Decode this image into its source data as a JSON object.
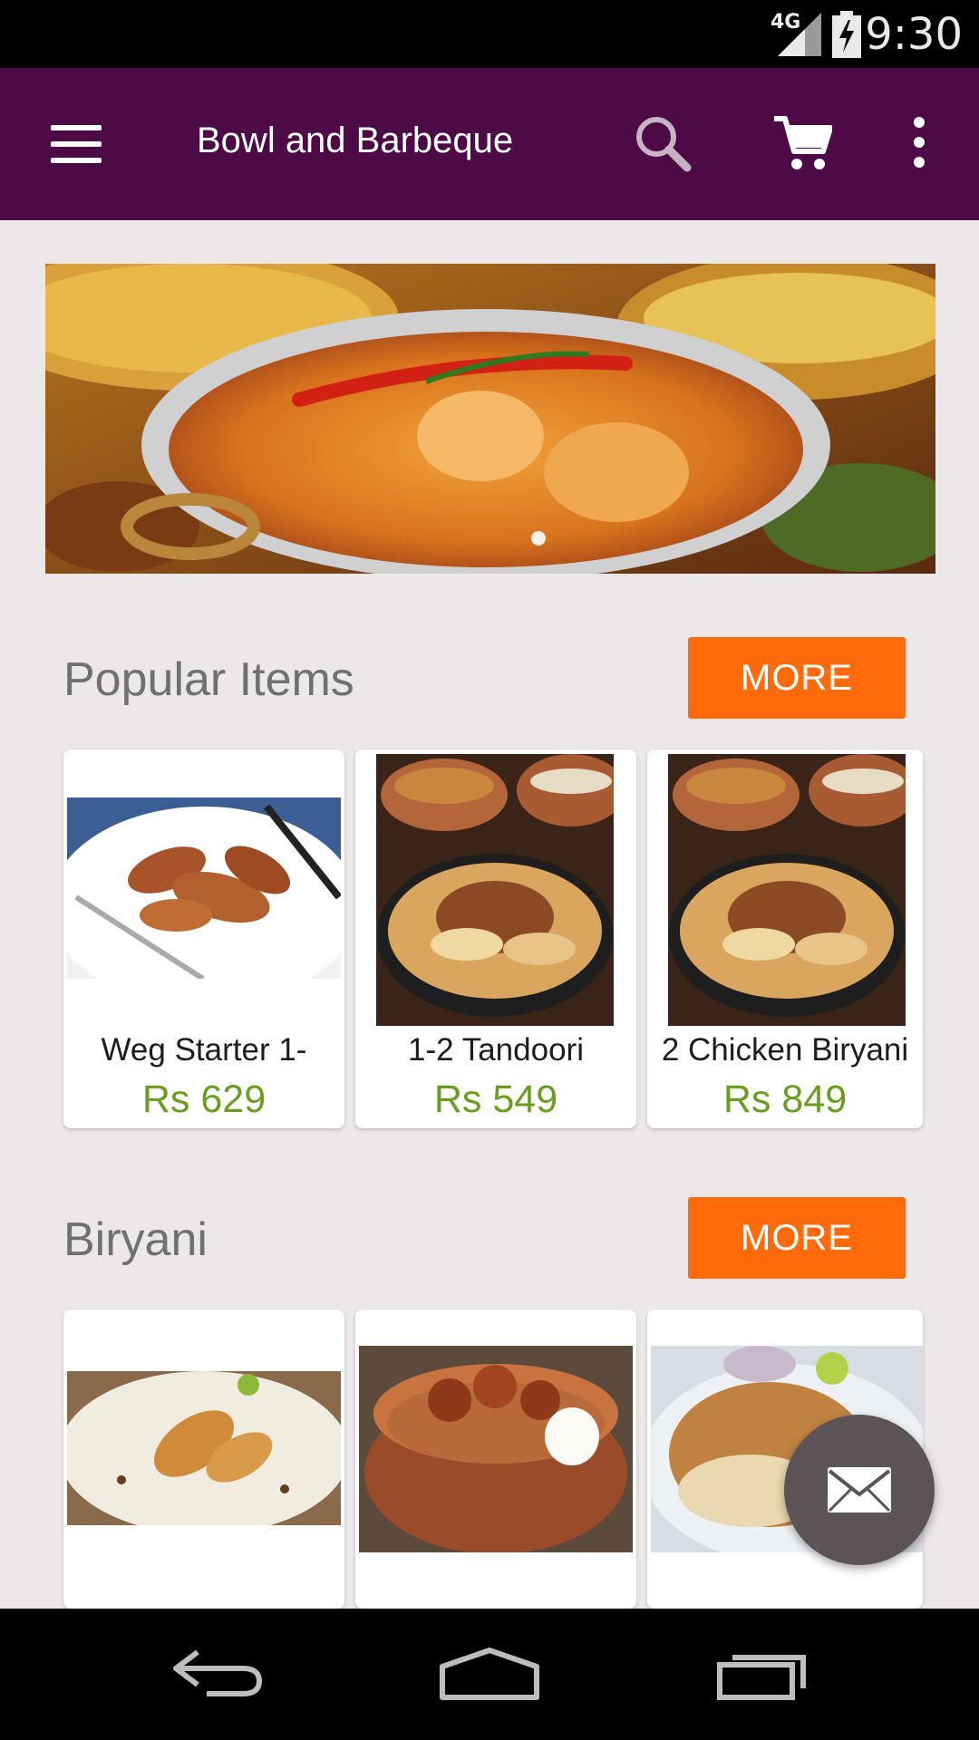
{
  "status": {
    "network": "4G",
    "time": "9:30"
  },
  "toolbar": {
    "title": "Bowl and Barbeque"
  },
  "banner": {
    "slide_count": 1,
    "active_slide": 1
  },
  "sections": [
    {
      "title": "Popular Items",
      "more_label": "MORE",
      "items": [
        {
          "name": "Weg Starter 1-",
          "price": "Rs 629"
        },
        {
          "name": "1-2 Tandoori",
          "price": "Rs 549"
        },
        {
          "name": "2 Chicken Biryani",
          "price": "Rs 849"
        }
      ]
    },
    {
      "title": "Biryani",
      "more_label": "MORE",
      "items": [
        {
          "name": "",
          "price": ""
        },
        {
          "name": "",
          "price": ""
        },
        {
          "name": "",
          "price": ""
        }
      ]
    }
  ],
  "colors": {
    "toolbar": "#4d0a47",
    "accent": "#ff6a0a",
    "price": "#6a9e1f",
    "background": "#ece7e9"
  }
}
